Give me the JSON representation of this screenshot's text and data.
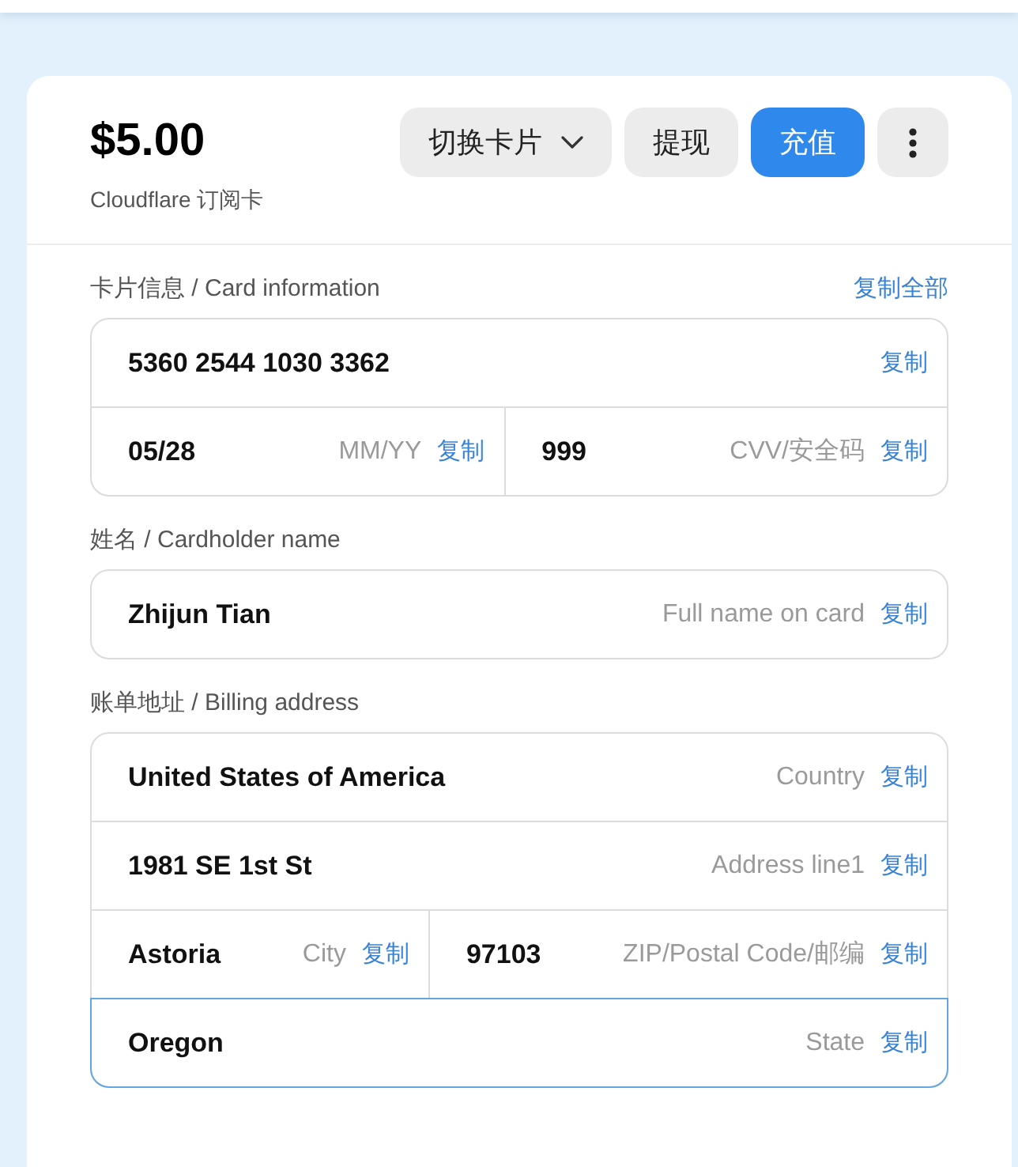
{
  "header": {
    "balance": "$5.00",
    "subtitle": "Cloudflare 订阅卡",
    "buttons": [
      {
        "kind": "dropdown",
        "label": "切换卡片"
      },
      {
        "kind": "secondary",
        "label": "提现"
      },
      {
        "kind": "primary",
        "label": "充值"
      },
      {
        "kind": "more"
      }
    ]
  },
  "sections": [
    {
      "label": "卡片信息 / Card information",
      "action": "复制全部",
      "rows": [
        {
          "fields": [
            {
              "value": "5360 2544 1030 3362",
              "copy": "复制",
              "focused": false
            }
          ]
        },
        {
          "fields": [
            {
              "value": "05/28",
              "hint": "MM/YY",
              "copy": "复制",
              "focused": false
            },
            {
              "value": "999",
              "hint": "CVV/安全码",
              "copy": "复制",
              "focused": false
            }
          ]
        }
      ]
    },
    {
      "label": "姓名 / Cardholder name",
      "rows": [
        {
          "fields": [
            {
              "value": "Zhijun Tian",
              "hint": "Full name on card",
              "copy": "复制",
              "focused": false
            }
          ]
        }
      ]
    },
    {
      "label": "账单地址 / Billing address",
      "rows": [
        {
          "fields": [
            {
              "value": "United States of America",
              "hint": "Country",
              "copy": "复制",
              "focused": false
            }
          ]
        },
        {
          "fields": [
            {
              "value": "1981 SE 1st St",
              "hint": "Address line1",
              "copy": "复制",
              "focused": false
            }
          ]
        },
        {
          "fields": [
            {
              "value": "Astoria",
              "hint": "City",
              "copy": "复制",
              "focused": false
            },
            {
              "value": "97103",
              "hint": "ZIP/Postal Code/邮编",
              "copy": "复制",
              "focused": false
            }
          ]
        },
        {
          "fields": [
            {
              "value": "Oregon",
              "hint": "State",
              "copy": "复制",
              "focused": true
            }
          ]
        }
      ]
    }
  ]
}
